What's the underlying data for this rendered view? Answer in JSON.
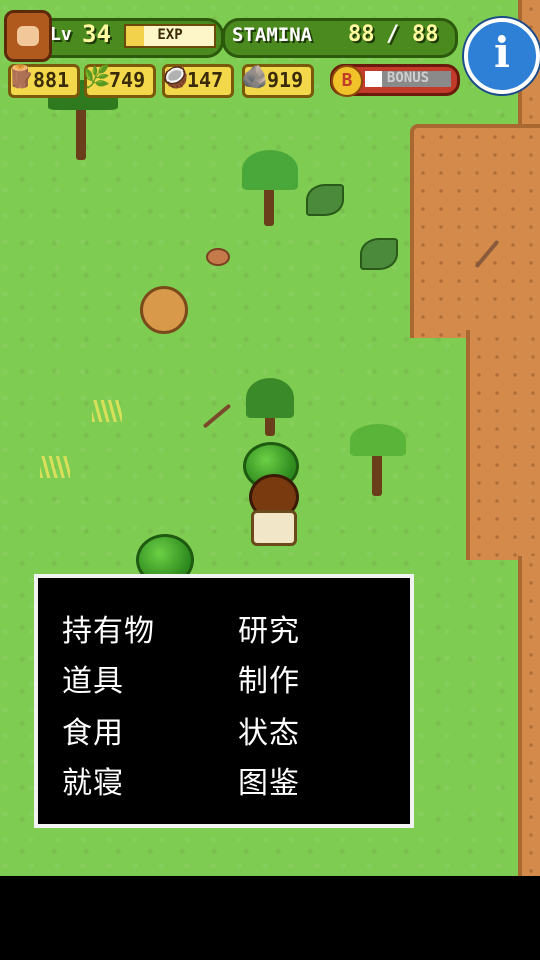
{
  "hud": {
    "level_label": "Lv",
    "level": "34",
    "exp_label": "EXP",
    "exp_fill": 0.2,
    "stamina_label": "STAMINA",
    "stamina_current": "88",
    "stamina_sep": "/",
    "stamina_max": "88",
    "info_icon": "i"
  },
  "resources": [
    {
      "icon": "branch-icon",
      "value": "881"
    },
    {
      "icon": "leaf-icon",
      "value": "749"
    },
    {
      "icon": "coconut-icon",
      "value": "147"
    },
    {
      "icon": "stone-icon",
      "value": "919"
    }
  ],
  "bonus": {
    "badge": "B",
    "label": "BONUS",
    "fill": 0.2
  },
  "menu": {
    "items": [
      "持有物",
      "研究",
      "道具",
      "制作",
      "食用",
      "状态",
      "就寝",
      "图鉴"
    ]
  },
  "colors": {
    "grass": "#7fcc52",
    "sand": "#d38a4a",
    "hud_green": "#4b8a1e",
    "menu_bg": "#000000",
    "menu_border": "#f2f2f2"
  }
}
